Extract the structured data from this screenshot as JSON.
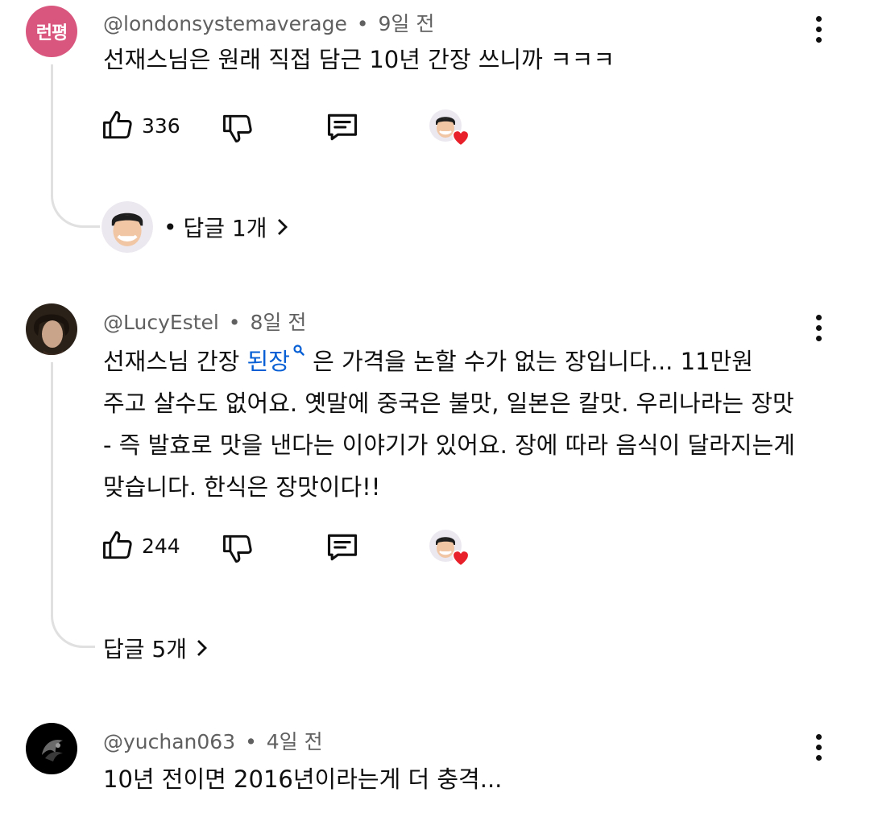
{
  "comments": [
    {
      "author": "@londonsystemaverage",
      "time": "9일 전",
      "avatar_text": "런평",
      "avatar_color": "#d9577f",
      "lines": [
        "선재스님은 원래 직접 담근 10년 간장 쓰니까 ㅋㅋㅋ"
      ],
      "likes": "336",
      "replies_label": "답글 1개"
    },
    {
      "author": "@LucyEstel",
      "time": "8일 전",
      "line1_before": "선재스님 간장 ",
      "line1_link": "된장",
      "line1_after": " 은 가격을 논할 수가 없는 장입니다... 11만원",
      "lines_rest": [
        "주고 살수도 없어요. 옛말에 중국은 불맛, 일본은 칼맛. 우리나라는 장맛",
        "- 즉 발효로 맛을 낸다는 이야기가 있어요. 장에 따라 음식이 달라지는게",
        "맞습니다. 한식은 장맛이다!!"
      ],
      "likes": "244",
      "replies_label": "답글 5개"
    },
    {
      "author": "@yuchan063",
      "time": "4일 전",
      "lines": [
        "10년 전이면 2016년이라는게 더 충격..."
      ]
    }
  ],
  "separator": "•",
  "colors": {
    "link": "#065fd4",
    "heart": "#e8202a",
    "avatar_pink": "#d9577f"
  }
}
